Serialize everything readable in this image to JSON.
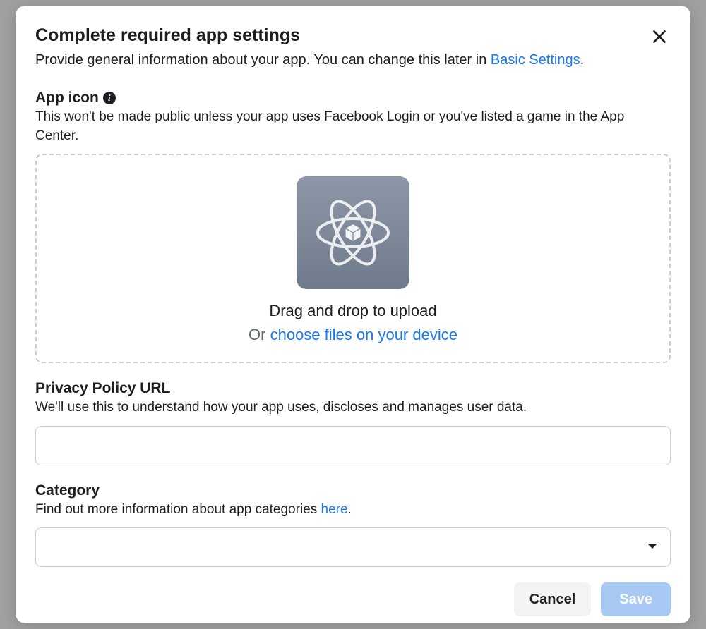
{
  "header": {
    "title": "Complete required app settings",
    "subtitle_pre": "Provide general information about your app. You can change this later in ",
    "subtitle_link": "Basic Settings",
    "subtitle_post": "."
  },
  "appIcon": {
    "label": "App icon",
    "help": "This won't be made public unless your app uses Facebook Login or you've listed a game in the App Center.",
    "drag_text": "Drag and drop to upload",
    "or_text": "Or ",
    "choose_link": "choose files on your device"
  },
  "privacy": {
    "label": "Privacy Policy URL",
    "help": "We'll use this to understand how your app uses, discloses and manages user data.",
    "value": ""
  },
  "category": {
    "label": "Category",
    "help_pre": "Find out more information about app categories ",
    "help_link": "here",
    "help_post": ".",
    "value": ""
  },
  "footer": {
    "cancel": "Cancel",
    "save": "Save"
  }
}
